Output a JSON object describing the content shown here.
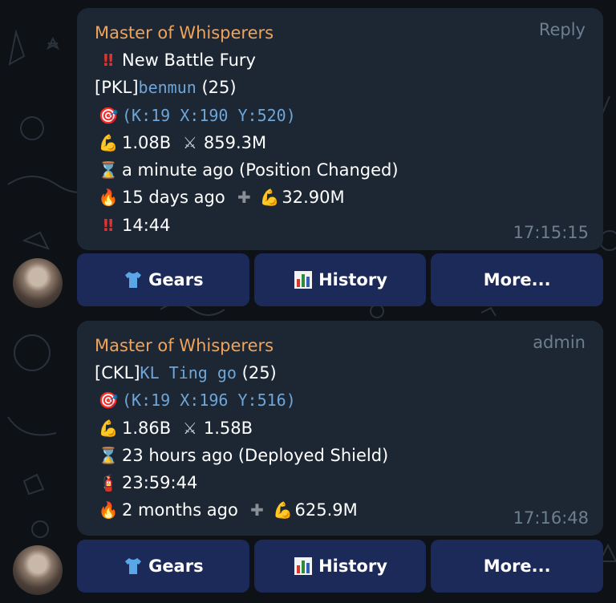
{
  "messages": [
    {
      "sender": "Master of Whisperers",
      "corner_label": "Reply",
      "lines": {
        "alert": "New Battle Fury",
        "name_prefix": "[PKL]",
        "name": "benmun",
        "level": "(25)",
        "coords": "(K:19 X:190 Y:520)",
        "power": "1.08B",
        "attack": "859.3M",
        "status": "a minute ago (Position Changed)",
        "fire": "15 days ago",
        "fire_gain": "32.90M",
        "timer": "14:44"
      },
      "time": "17:15:15"
    },
    {
      "sender": "Master of Whisperers",
      "corner_label": "admin",
      "lines": {
        "name_prefix": "[CKL]",
        "name": "KL Ting go",
        "level": "(25)",
        "coords": "(K:19 X:196 Y:516)",
        "power": "1.86B",
        "attack": "1.58B",
        "status": "23 hours ago (Deployed Shield)",
        "shield": "23:59:44",
        "fire": "2 months ago",
        "fire_gain": "625.9M"
      },
      "time": "17:16:48"
    }
  ],
  "buttons": {
    "gears": "Gears",
    "history": "History",
    "more": "More..."
  },
  "icons": {
    "alert": "double-exclamation-icon",
    "target": "direct-hit-target-icon",
    "power": "flexed-biceps-icon",
    "attack": "crossed-swords-icon",
    "status": "hourglass-icon",
    "fire": "fire-icon",
    "plus": "heavy-plus-icon",
    "shield": "fire-extinguisher-icon",
    "gears": "t-shirt-icon",
    "history": "bar-chart-icon"
  },
  "colors": {
    "background": "#0e1116",
    "bubble": "#1c2733",
    "button": "#1c2a5a",
    "sender": "#f0a35b",
    "meta": "#6d7f8f",
    "mono_text": "#6ea6d9"
  }
}
